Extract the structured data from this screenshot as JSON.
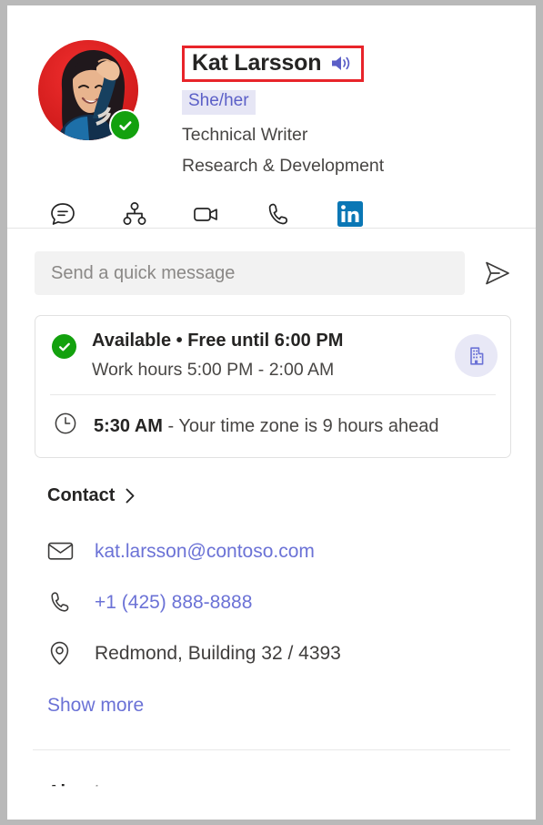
{
  "profile": {
    "name": "Kat Larsson",
    "pronunciation_icon": "speaker-sound-icon",
    "pronouns": "She/her",
    "job_title": "Technical Writer",
    "department": "Research & Development",
    "presence": "available",
    "avatar_alt": "Kat Larsson profile photo"
  },
  "actions": [
    {
      "name": "chat-icon",
      "label": "Chat"
    },
    {
      "name": "org-chart-icon",
      "label": "Organization"
    },
    {
      "name": "video-call-icon",
      "label": "Video call"
    },
    {
      "name": "phone-call-icon",
      "label": "Audio call"
    },
    {
      "name": "linkedin-icon",
      "label": "LinkedIn"
    }
  ],
  "quick_message": {
    "placeholder": "Send a quick message",
    "value": "",
    "send_label": "Send"
  },
  "status_card": {
    "availability": "Available • Free until 6:00 PM",
    "work_hours": "Work hours 5:00 PM - 2:00 AM",
    "local_time": "5:30 AM",
    "timezone_note": " - Your time zone is 9 hours ahead",
    "org_icon": "building-icon"
  },
  "contact": {
    "title": "Contact",
    "items": [
      {
        "icon": "mail-icon",
        "value": "kat.larsson@contoso.com",
        "type": "link"
      },
      {
        "icon": "phone-icon",
        "value": "+1 (425) 888-8888",
        "type": "link"
      },
      {
        "icon": "location-pin-icon",
        "value": "Redmond, Building 32 / 4393",
        "type": "plain"
      }
    ],
    "show_more": "Show more"
  },
  "next_section_peek": "About",
  "colors": {
    "accent_link": "#6b72d6",
    "pronoun_text": "#5b5fc7",
    "pronoun_background": "#e6e6f5",
    "presence_available": "#13a10e",
    "linkedin_blue": "#0a77b5",
    "annotation_red": "#e8242a",
    "text_primary": "#252423",
    "text_secondary": "#484644",
    "input_background": "#f2f2f2",
    "border": "#e1e1e1"
  }
}
